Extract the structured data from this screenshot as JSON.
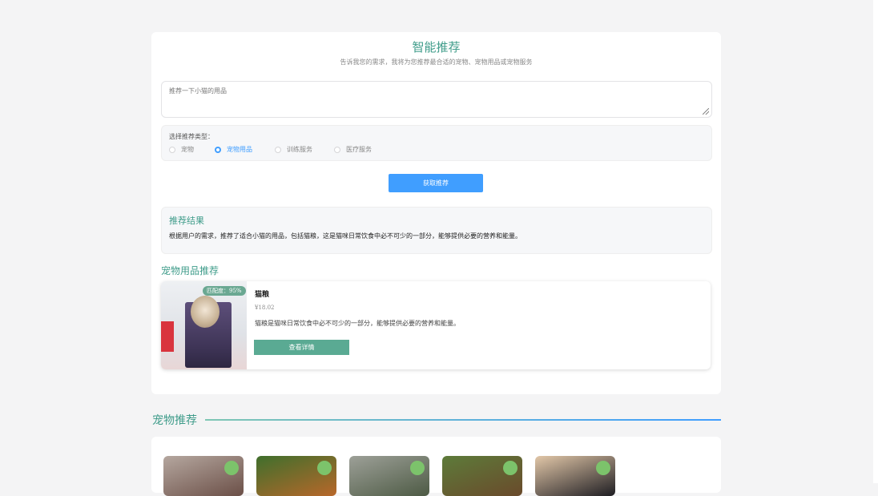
{
  "header": {
    "title": "智能推荐",
    "subtitle": "告诉我您的需求，我将为您推荐最合适的宠物、宠物用品或宠物服务"
  },
  "query": {
    "value": "推荐一下小猫的用品"
  },
  "type_select": {
    "label": "选择推荐类型：",
    "options": [
      "宠物",
      "宠物用品",
      "训练服务",
      "医疗服务"
    ],
    "selected": "宠物用品"
  },
  "submit_label": "获取推荐",
  "result": {
    "heading": "推荐结果",
    "text": "根据用户的需求，推荐了适合小猫的用品，包括猫粮，这是猫咪日常饮食中必不可少的一部分，能够提供必要的营养和能量。"
  },
  "products_section": {
    "title": "宠物用品推荐",
    "items": [
      {
        "badge": "匹配度：95%",
        "name": "猫粮",
        "price": "¥18.02",
        "description": "猫粮是猫咪日常饮食中必不可少的一部分，能够提供必要的营养和能量。",
        "button": "查看详情"
      }
    ]
  },
  "pets_section": {
    "title": "宠物推荐",
    "pets": [
      {
        "photo": "pet-photo-1",
        "colors": [
          "#6b4f47",
          "#b5a79f"
        ]
      },
      {
        "photo": "pet-photo-2",
        "colors": [
          "#b8672a",
          "#3f6f2c"
        ]
      },
      {
        "photo": "pet-photo-3",
        "colors": [
          "#4d5a44",
          "#9da098"
        ]
      },
      {
        "photo": "pet-photo-4",
        "colors": [
          "#6a4a2b",
          "#5d7b3a"
        ]
      },
      {
        "photo": "pet-photo-5",
        "colors": [
          "#1e1d22",
          "#e2c7a8"
        ]
      }
    ]
  },
  "colors": {
    "accent": "#409eff",
    "brand": "#3f9c8a",
    "button": "#5aaa93"
  }
}
